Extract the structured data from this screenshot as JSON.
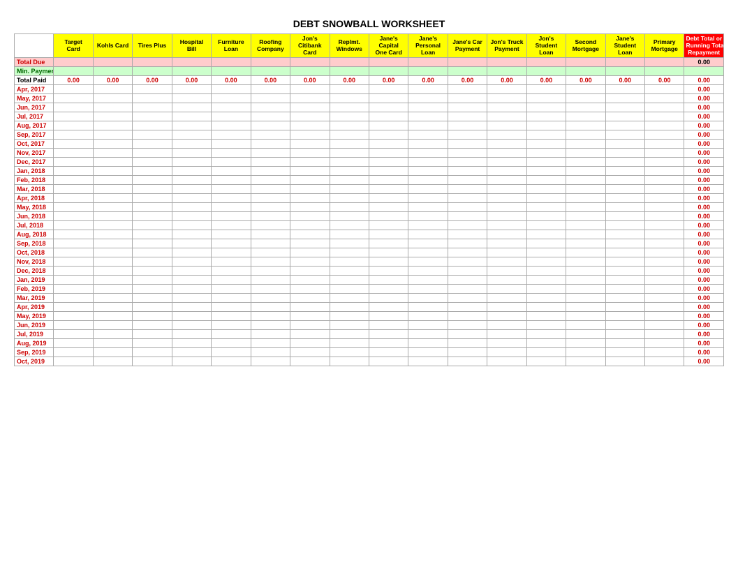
{
  "title": "DEBT SNOWBALL WORKSHEET",
  "columns": [
    {
      "key": "date",
      "label": "",
      "label2": "",
      "label3": ""
    },
    {
      "key": "target",
      "label": "Target",
      "label2": "Card",
      "label3": ""
    },
    {
      "key": "kohls",
      "label": "Kohls Card",
      "label2": "",
      "label3": ""
    },
    {
      "key": "tires",
      "label": "Tires Plus",
      "label2": "",
      "label3": ""
    },
    {
      "key": "hospital",
      "label": "Hospital",
      "label2": "Bill",
      "label3": ""
    },
    {
      "key": "furniture",
      "label": "Furniture",
      "label2": "Loan",
      "label3": ""
    },
    {
      "key": "roofing",
      "label": "Roofing",
      "label2": "Company",
      "label3": ""
    },
    {
      "key": "jons_citibank",
      "label": "Jon's",
      "label2": "Citibank",
      "label3": "Card"
    },
    {
      "key": "replmt_windows",
      "label": "Replmt.",
      "label2": "Windows",
      "label3": ""
    },
    {
      "key": "janes_capital",
      "label": "Jane's",
      "label2": "Capital",
      "label3": "One Card"
    },
    {
      "key": "janes_personal",
      "label": "Jane's",
      "label2": "Personal",
      "label3": "Loan"
    },
    {
      "key": "janes_car",
      "label": "Jane's Car",
      "label2": "Payment",
      "label3": ""
    },
    {
      "key": "jons_truck",
      "label": "Jon's Truck",
      "label2": "Payment",
      "label3": ""
    },
    {
      "key": "jons_student",
      "label": "Jon's",
      "label2": "Student",
      "label3": "Loan"
    },
    {
      "key": "second_mortgage",
      "label": "Second",
      "label2": "Mortgage",
      "label3": ""
    },
    {
      "key": "janes_student",
      "label": "Jane's",
      "label2": "Student",
      "label3": "Loan"
    },
    {
      "key": "primary_mortgage",
      "label": "Primary",
      "label2": "Mortgage",
      "label3": ""
    },
    {
      "key": "debt_total",
      "label": "Debt Total or",
      "label2": "Running Total",
      "label3": "Repayment"
    }
  ],
  "total_due_label": "Total Due",
  "min_payment_label": "Min. Payment",
  "total_paid_label": "Total Paid",
  "total_paid_values": [
    "0.00",
    "0.00",
    "0.00",
    "0.00",
    "0.00",
    "0.00",
    "0.00",
    "0.00",
    "0.00",
    "0.00",
    "0.00",
    "0.00",
    "0.00",
    "0.00",
    "0.00",
    "0.00",
    "0.00"
  ],
  "debt_total_due": "0.00",
  "rows": [
    "Apr, 2017",
    "May, 2017",
    "Jun, 2017",
    "Jul, 2017",
    "Aug, 2017",
    "Sep, 2017",
    "Oct, 2017",
    "Nov, 2017",
    "Dec, 2017",
    "Jan, 2018",
    "Feb, 2018",
    "Mar, 2018",
    "Apr, 2018",
    "May, 2018",
    "Jun, 2018",
    "Jul, 2018",
    "Aug, 2018",
    "Sep, 2018",
    "Oct, 2018",
    "Nov, 2018",
    "Dec, 2018",
    "Jan, 2019",
    "Feb, 2019",
    "Mar, 2019",
    "Apr, 2019",
    "May, 2019",
    "Jun, 2019",
    "Jul, 2019",
    "Aug, 2019",
    "Sep, 2019",
    "Oct, 2019"
  ],
  "num_data_cols": 16,
  "row_value": "0.00"
}
